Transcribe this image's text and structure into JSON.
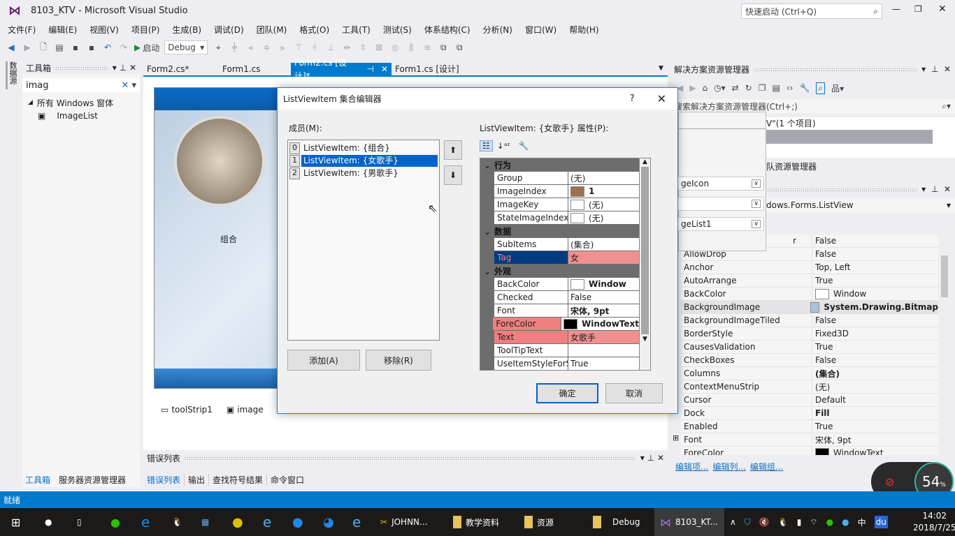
{
  "window": {
    "title": "8103_KTV - Microsoft Visual Studio",
    "quick_launch": "快速启动 (Ctrl+Q)"
  },
  "menu": [
    "文件(F)",
    "编辑(E)",
    "视图(V)",
    "项目(P)",
    "生成(B)",
    "调试(D)",
    "团队(M)",
    "格式(O)",
    "工具(T)",
    "测试(S)",
    "体系结构(C)",
    "分析(N)",
    "窗口(W)",
    "帮助(H)"
  ],
  "toolbar": {
    "start_label": "启动",
    "config": "Debug"
  },
  "side_strip": {
    "label": "数据源"
  },
  "toolbox": {
    "title": "工具箱",
    "search": "imag",
    "group": "所有 Windows 窗体",
    "items": [
      "ImageList"
    ]
  },
  "doc_tabs": [
    "Form2.cs*",
    "Form1.cs",
    "Form2.cs [设计]*",
    "Form1.cs [设计]"
  ],
  "designer": {
    "item_label": "组合",
    "tray": [
      "toolStrip1",
      "image"
    ]
  },
  "error_panel": {
    "title": "错误列表"
  },
  "bottom_tabs_left": [
    "工具箱",
    "服务器资源管理器"
  ],
  "bottom_tabs_mid": [
    "错误列表",
    "输出",
    "查找符号结果",
    "命令窗口"
  ],
  "solution": {
    "title": "解决方案资源管理器",
    "search": "搜索解决方案资源管理器(Ctrl+;)",
    "tree_item": "V\"(1 个项目)",
    "team": "队资源管理器"
  },
  "popup": {
    "combos": [
      "geIcon",
      "",
      "geList1"
    ]
  },
  "properties": {
    "object": "dows.Forms.ListView",
    "rows": [
      {
        "name": "r",
        "value": "False"
      },
      {
        "name": "AllowDrop",
        "value": "False"
      },
      {
        "name": "Anchor",
        "value": "Top, Left"
      },
      {
        "name": "AutoArrange",
        "value": "True"
      },
      {
        "name": "BackColor",
        "value": "Window",
        "swatch": "#ffffff"
      },
      {
        "name": "BackgroundImage",
        "value": "System.Drawing.Bitmap",
        "bold": true,
        "swatch": "#a8c4dc"
      },
      {
        "name": "BackgroundImageTiled",
        "value": "False"
      },
      {
        "name": "BorderStyle",
        "value": "Fixed3D"
      },
      {
        "name": "CausesValidation",
        "value": "True"
      },
      {
        "name": "CheckBoxes",
        "value": "False"
      },
      {
        "name": "Columns",
        "value": "(集合)",
        "bold": true
      },
      {
        "name": "ContextMenuStrip",
        "value": "(无)"
      },
      {
        "name": "Cursor",
        "value": "Default"
      },
      {
        "name": "Dock",
        "value": "Fill",
        "bold": true
      },
      {
        "name": "Enabled",
        "value": "True"
      },
      {
        "name": "Font",
        "value": "宋体, 9pt"
      },
      {
        "name": "ForeColor",
        "value": "WindowText",
        "swatch": "#000000"
      }
    ],
    "links": [
      "编辑项...",
      "编辑列...",
      "编辑组..."
    ]
  },
  "dialog": {
    "title": "ListViewItem 集合编辑器",
    "help": "?",
    "members_label": "成员(M):",
    "members": [
      {
        "index": "0",
        "label": "ListViewItem: {组合}"
      },
      {
        "index": "1",
        "label": "ListViewItem: {女歌手}",
        "selected": true
      },
      {
        "index": "2",
        "label": "ListViewItem: {男歌手}"
      }
    ],
    "props_label": "ListViewItem: {女歌手} 属性(P):",
    "add": "添加(A)",
    "remove": "移除(R)",
    "ok": "确定",
    "cancel": "取消",
    "categories": [
      {
        "name": "行为",
        "rows": [
          {
            "name": "Group",
            "value": "(无)"
          },
          {
            "name": "ImageIndex",
            "value": "1",
            "bold": true,
            "swatch": "#a0704a"
          },
          {
            "name": "ImageKey",
            "value": "(无)",
            "swatch": "#ffffff"
          },
          {
            "name": "StateImageIndex",
            "value": "(无)",
            "swatch": "#ffffff"
          }
        ]
      },
      {
        "name": "数据",
        "rows": [
          {
            "name": "SubItems",
            "value": "(集合)"
          },
          {
            "name": "Tag",
            "value": "女",
            "selected": true,
            "highlight": true
          }
        ]
      },
      {
        "name": "外观",
        "rows": [
          {
            "name": "BackColor",
            "value": "Window",
            "bold": true,
            "swatch": "#ffffff"
          },
          {
            "name": "Checked",
            "value": "False"
          },
          {
            "name": "Font",
            "value": "宋体, 9pt",
            "bold": true
          },
          {
            "name": "ForeColor",
            "value": "WindowText",
            "bold": true,
            "swatch": "#000000",
            "highlight": true
          },
          {
            "name": "Text",
            "value": "女歌手",
            "highlight": true
          },
          {
            "name": "ToolTipText",
            "value": ""
          },
          {
            "name": "UseItemStyleForSubItems",
            "value": "True"
          }
        ]
      }
    ]
  },
  "status": {
    "text": "就绪"
  },
  "network_widget": {
    "percent": "54",
    "unit": "%"
  },
  "taskbar": {
    "items": [
      "JOHNN...",
      "教学资料",
      "资源",
      "Debug",
      "8103_KT..."
    ],
    "time": "14:02",
    "date": "2018/7/25",
    "ime": "中",
    "tray_app": "du"
  },
  "colors": {
    "accent": "#007acc",
    "selection": "#0063cc",
    "highlight": "#f08080"
  }
}
